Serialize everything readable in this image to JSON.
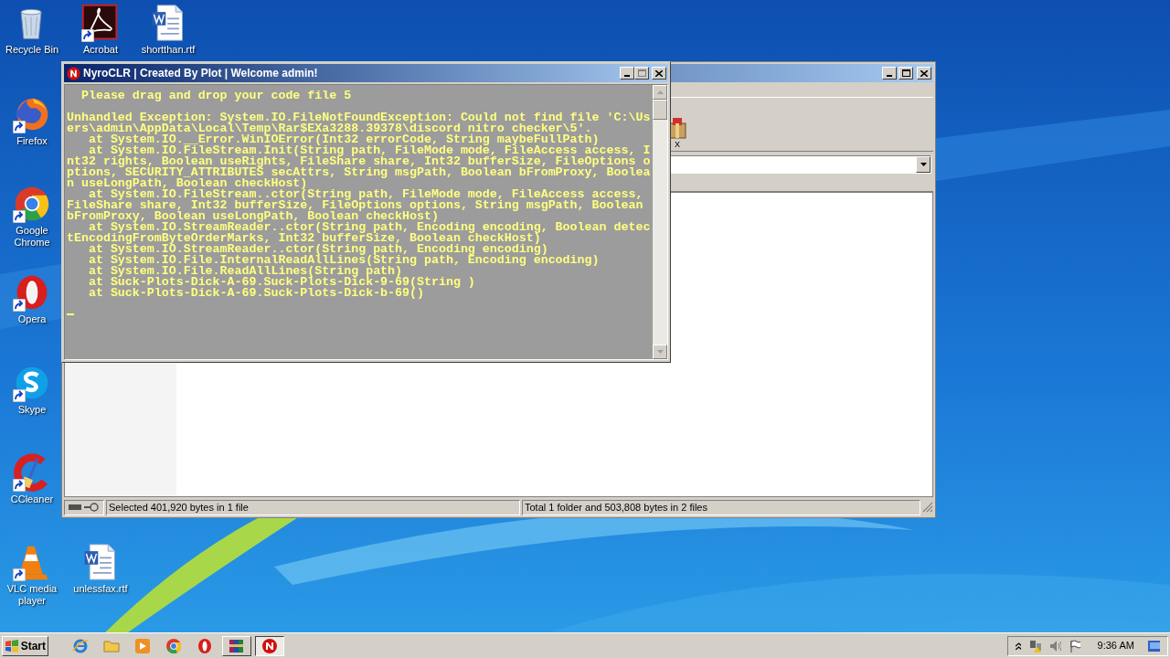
{
  "desktop": {
    "icons": [
      {
        "label": "Recycle Bin",
        "kind": "recycle",
        "shortcut": false
      },
      {
        "label": "Acrobat",
        "kind": "acrobat",
        "shortcut": true
      },
      {
        "label": "shortthan.rtf",
        "kind": "word",
        "shortcut": false
      },
      {
        "label": "Firefox",
        "kind": "firefox",
        "shortcut": true
      },
      {
        "label": "Google Chrome",
        "kind": "chrome",
        "shortcut": true
      },
      {
        "label": "Opera",
        "kind": "opera",
        "shortcut": true
      },
      {
        "label": "Skype",
        "kind": "skype",
        "shortcut": true
      },
      {
        "label": "CCleaner",
        "kind": "ccleaner",
        "shortcut": true
      },
      {
        "label": "VLC media player",
        "kind": "vlc",
        "shortcut": true
      },
      {
        "label": "unlessfax.rtf",
        "kind": "word",
        "shortcut": false
      }
    ]
  },
  "explorer_window": {
    "toolbar_label": "X",
    "status_bar": [
      "Selected 401,920 bytes in 1 file",
      "Total 1 folder and 503,808 bytes in 2 files"
    ]
  },
  "console_window": {
    "title": "NyroCLR | Created By Plot | Welcome admin!",
    "prompt": "  Please drag and drop your code file 5",
    "lines": [
      "Unhandled Exception: System.IO.FileNotFoundException: Could not find file 'C:\\Us",
      "ers\\admin\\AppData\\Local\\Temp\\Rar$EXa3288.39378\\discord nitro checker\\5'.",
      "   at System.IO.__Error.WinIOError(Int32 errorCode, String maybeFullPath)",
      "   at System.IO.FileStream.Init(String path, FileMode mode, FileAccess access, I",
      "nt32 rights, Boolean useRights, FileShare share, Int32 bufferSize, FileOptions o",
      "ptions, SECURITY_ATTRIBUTES secAttrs, String msgPath, Boolean bFromProxy, Boolea",
      "n useLongPath, Boolean checkHost)",
      "   at System.IO.FileStream..ctor(String path, FileMode mode, FileAccess access,",
      "FileShare share, Int32 bufferSize, FileOptions options, String msgPath, Boolean",
      "bFromProxy, Boolean useLongPath, Boolean checkHost)",
      "   at System.IO.StreamReader..ctor(String path, Encoding encoding, Boolean detec",
      "tEncodingFromByteOrderMarks, Int32 bufferSize, Boolean checkHost)",
      "   at System.IO.StreamReader..ctor(String path, Encoding encoding)",
      "   at System.IO.File.InternalReadAllLines(String path, Encoding encoding)",
      "   at System.IO.File.ReadAllLines(String path)",
      "   at Suck-Plots-Dick-A-69.Suck-Plots-Dick-9-69(String )",
      "   at Suck-Plots-Dick-A-69.Suck-Plots-Dick-b-69()"
    ]
  },
  "taskbar": {
    "start": "Start",
    "apps": [
      {
        "kind": "ie",
        "selected": false
      },
      {
        "kind": "folder",
        "selected": false
      },
      {
        "kind": "media",
        "selected": false
      },
      {
        "kind": "chrome",
        "selected": false
      },
      {
        "kind": "opera",
        "selected": false
      },
      {
        "kind": "winrar",
        "selected": false
      },
      {
        "kind": "nyro",
        "selected": true
      }
    ],
    "clock": "9:36 AM"
  }
}
